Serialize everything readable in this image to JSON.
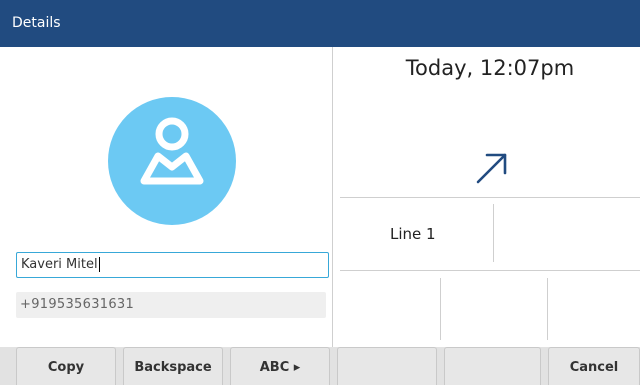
{
  "window": {
    "title": "Details"
  },
  "contact": {
    "name_value": "Kaveri Mitel",
    "number": "+919535631631"
  },
  "call": {
    "datetime": "Today, 12:07pm",
    "direction_icon": "outgoing-call-arrow-icon",
    "line_label": "Line 1"
  },
  "softkeys": [
    "Copy",
    "Backspace",
    "ABC ▸",
    "",
    "",
    "Cancel"
  ],
  "colors": {
    "titlebar": "#214b80",
    "avatar": "#6cc9f3",
    "arrow": "#214b80",
    "focus_border": "#38a8d8"
  }
}
